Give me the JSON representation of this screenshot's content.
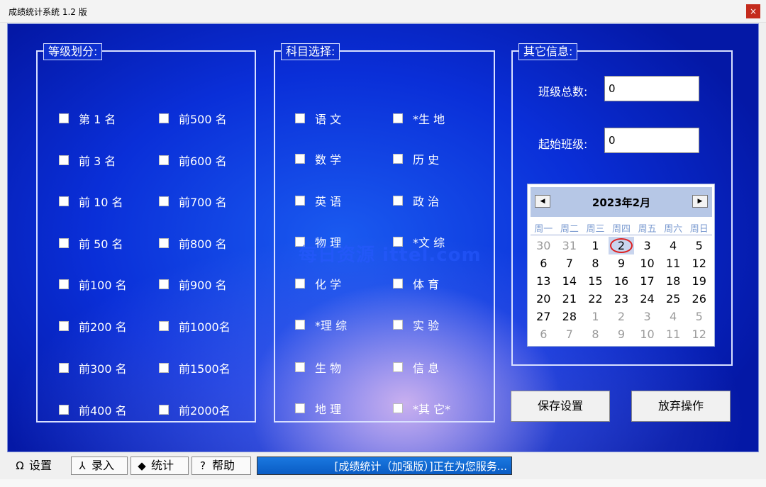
{
  "window": {
    "title": "成绩统计系统 1.2 版",
    "close_glyph": "×"
  },
  "grade_group": {
    "legend": "等级划分:",
    "col1": [
      "第 1 名",
      "前 3 名",
      "前 10 名",
      "前 50 名",
      "前100 名",
      "前200 名",
      "前300 名",
      "前400 名"
    ],
    "col2": [
      "前500 名",
      "前600 名",
      "前700 名",
      "前800 名",
      "前900 名",
      "前1000名",
      "前1500名",
      "前2000名"
    ]
  },
  "subject_group": {
    "legend": "科目选择:",
    "col1": [
      "语 文",
      "数 学",
      "英 语",
      "物 理",
      "化 学",
      "*理 综",
      "生 物",
      "地 理"
    ],
    "col2": [
      "*生 地",
      "历 史",
      "政 治",
      "*文 综",
      "体 育",
      "实 验",
      "信 息",
      "*其 它*"
    ]
  },
  "info_group": {
    "legend": "其它信息:",
    "class_total_label": "班级总数:",
    "class_total_value": "0",
    "start_class_label": "起始班级:",
    "start_class_value": "0"
  },
  "calendar": {
    "title": "2023年2月",
    "prev_glyph": "◀",
    "next_glyph": "▶",
    "weekdays": [
      "周一",
      "周二",
      "周三",
      "周四",
      "周五",
      "周六",
      "周日"
    ],
    "days": [
      "30",
      "31",
      "1",
      "2",
      "3",
      "4",
      "5",
      "6",
      "7",
      "8",
      "9",
      "10",
      "11",
      "12",
      "13",
      "14",
      "15",
      "16",
      "17",
      "18",
      "19",
      "20",
      "21",
      "22",
      "23",
      "24",
      "25",
      "26",
      "27",
      "28",
      "1",
      "2",
      "3",
      "4",
      "5",
      "6",
      "7",
      "8",
      "9",
      "10",
      "11",
      "12"
    ],
    "selected_day": "2"
  },
  "buttons": {
    "save": "保存设置",
    "cancel": "放弃操作"
  },
  "tabs": [
    {
      "icon": "Ω",
      "label": "设置"
    },
    {
      "icon": "⅄",
      "label": "录入"
    },
    {
      "icon": "◆",
      "label": "统计"
    },
    {
      "icon": "?",
      "label": "帮助"
    }
  ],
  "status": "[成绩统计（加强版）]正在为您服务...",
  "watermark": "每日资源 ittel.com"
}
